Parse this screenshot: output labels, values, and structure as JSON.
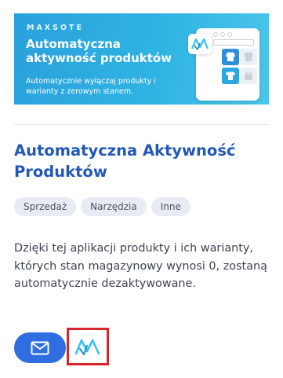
{
  "banner": {
    "brand": "MAXSOTE",
    "title": "Automatyczna aktywność produktów",
    "description": "Automatycznie wyłączaj produkty i warianty z zerowym stanem."
  },
  "app": {
    "title": "Automatyczna Aktywność Produktów",
    "tags": [
      "Sprzedaż",
      "Narzędzia",
      "Inne"
    ],
    "description": "Dzięki tej aplikacji produkty i ich warianty, których stan magazynowy wynosi 0, zostaną automatycznie dezaktywowane."
  },
  "icons": {
    "contact": "mail-icon",
    "vendor": "maxsote-logo-icon"
  },
  "colors": {
    "banner_gradient_start": "#2aa1dc",
    "banner_gradient_end": "#4cc6ea",
    "title": "#2359b5",
    "tag_bg": "#e8ebf3",
    "button": "#2f6ee0",
    "highlight_border": "#d7262c",
    "logo_cyan": "#35c3ee"
  }
}
